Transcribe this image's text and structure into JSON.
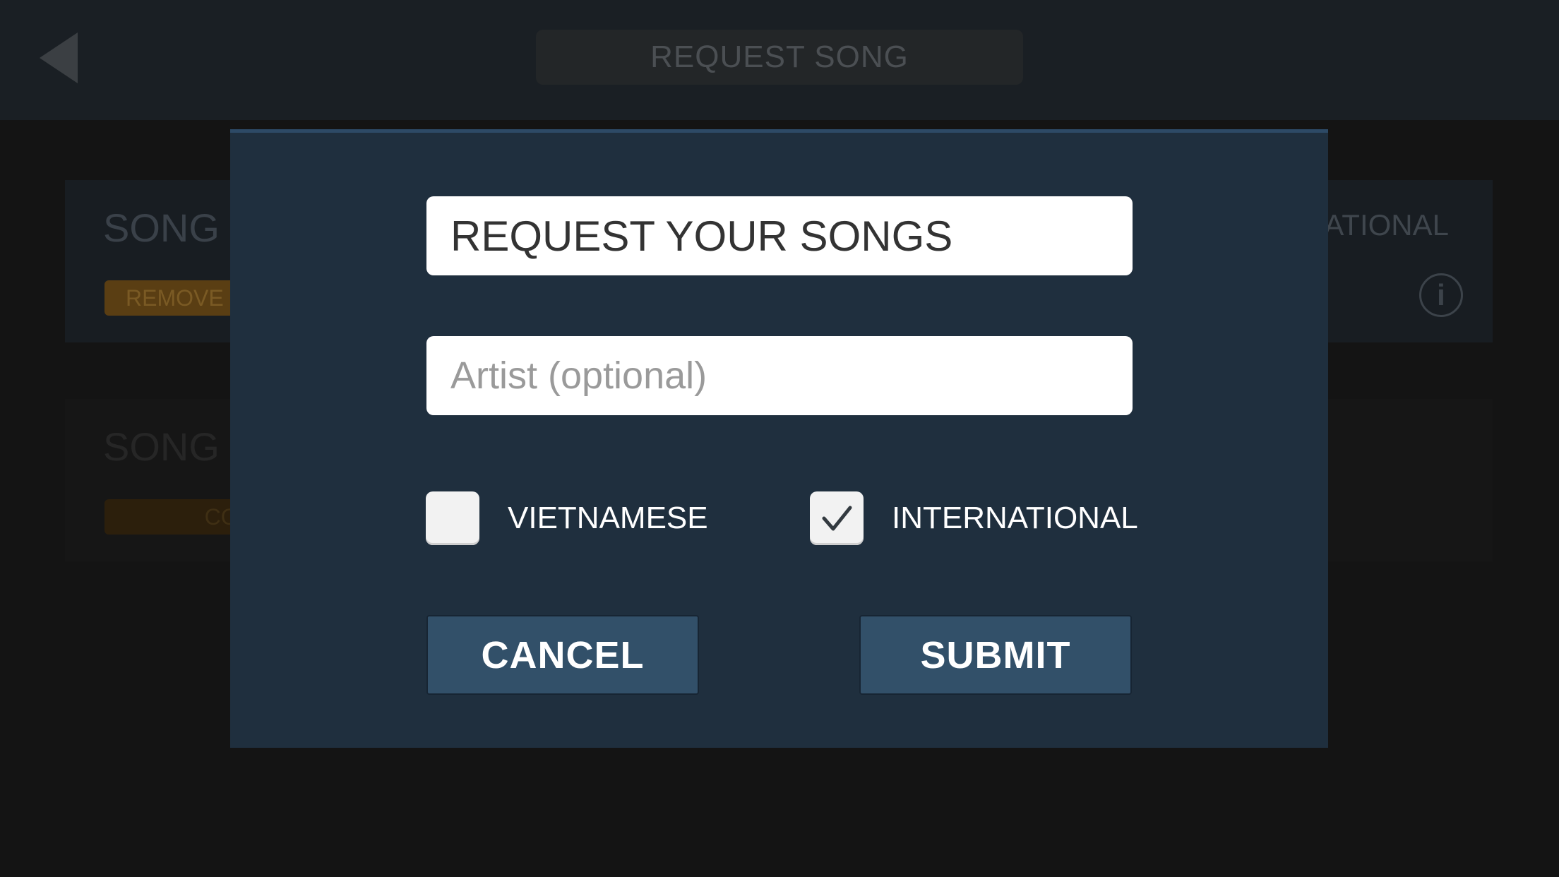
{
  "header": {
    "title": "REQUEST SONG",
    "back_icon": "back-triangle-icon"
  },
  "background_cards": [
    {
      "title": "SONG",
      "tag": "NATIONAL",
      "pill": "REMOVE",
      "info_icon_glyph": "i"
    },
    {
      "title": "SONG",
      "pill": "COMIN"
    }
  ],
  "dialog": {
    "song_field": {
      "value": "REQUEST YOUR SONGS"
    },
    "artist_field": {
      "placeholder": "Artist (optional)"
    },
    "checkboxes": [
      {
        "label": "VIETNAMESE",
        "checked": false
      },
      {
        "label": "INTERNATIONAL",
        "checked": true
      }
    ],
    "cancel_label": "CANCEL",
    "submit_label": "SUBMIT"
  },
  "colors": {
    "overlay": "#141414",
    "dialog_bg": "#1f2f3e",
    "button_bg": "#325069",
    "pill_orange": "#5a3e13"
  }
}
